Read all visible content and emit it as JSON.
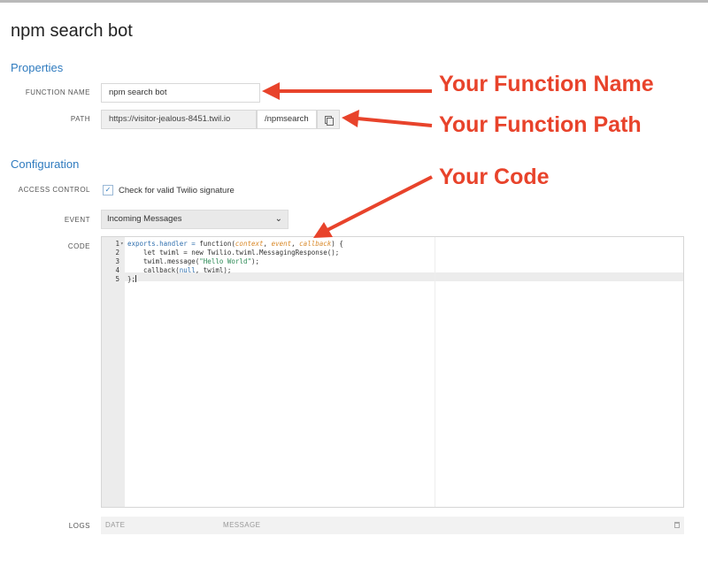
{
  "page": {
    "title": "npm search bot"
  },
  "sections": {
    "properties": "Properties",
    "configuration": "Configuration"
  },
  "fields": {
    "function_name": {
      "label": "FUNCTION NAME",
      "value": "npm search bot"
    },
    "path": {
      "label": "PATH",
      "domain": "https://visitor-jealous-8451.twil.io",
      "value": "/npmsearch"
    },
    "access_control": {
      "label": "ACCESS CONTROL",
      "checkbox_label": "Check for valid Twilio signature",
      "checked": true
    },
    "event": {
      "label": "EVENT",
      "selected": "Incoming Messages"
    },
    "code": {
      "label": "CODE",
      "line_numbers": [
        "1",
        "2",
        "3",
        "4",
        "5"
      ],
      "lines": [
        [
          {
            "t": "exports.handler = ",
            "c": "tok-k"
          },
          {
            "t": "function",
            "c": ""
          },
          {
            "t": "(",
            "c": ""
          },
          {
            "t": "context",
            "c": "tok-p"
          },
          {
            "t": ", ",
            "c": ""
          },
          {
            "t": "event",
            "c": "tok-p"
          },
          {
            "t": ", ",
            "c": ""
          },
          {
            "t": "callback",
            "c": "tok-p"
          },
          {
            "t": ") {",
            "c": ""
          }
        ],
        [
          {
            "t": "    let twiml = new Twilio.twiml.MessagingResponse();",
            "c": ""
          }
        ],
        [
          {
            "t": "    twiml.message(",
            "c": ""
          },
          {
            "t": "\"Hello World\"",
            "c": "tok-s"
          },
          {
            "t": ");",
            "c": ""
          }
        ],
        [
          {
            "t": "    callback(",
            "c": ""
          },
          {
            "t": "null",
            "c": "tok-k"
          },
          {
            "t": ", twiml);",
            "c": ""
          }
        ],
        [
          {
            "t": "};",
            "c": ""
          }
        ]
      ]
    },
    "logs": {
      "label": "LOGS",
      "col_date": "DATE",
      "col_message": "MESSAGE"
    }
  },
  "annotations": {
    "function_name": "Your Function Name",
    "function_path": "Your Function Path",
    "code": "Your Code",
    "color": "#e8432b"
  },
  "icons": {
    "copy": "copy-icon",
    "chevron": "chevron-down-icon",
    "checkmark": "checkmark-icon",
    "fold": "fold-arrow-icon",
    "trash": "trash-icon"
  }
}
